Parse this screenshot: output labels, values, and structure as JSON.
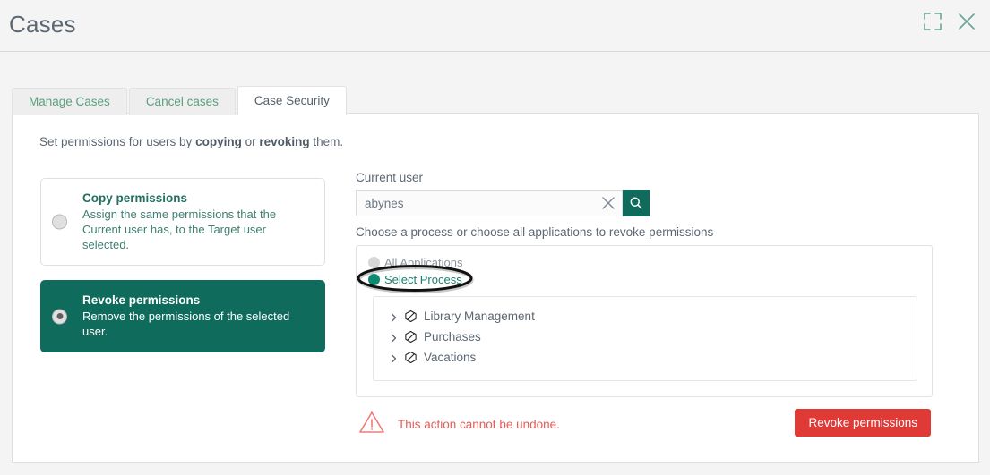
{
  "header": {
    "title": "Cases",
    "expand_icon": "expand-icon",
    "close_icon": "close-icon"
  },
  "tabs": [
    {
      "label": "Manage Cases",
      "active": false
    },
    {
      "label": "Cancel cases",
      "active": false
    },
    {
      "label": "Case Security",
      "active": true
    }
  ],
  "main": {
    "intro_prefix": "Set permissions for users by ",
    "intro_bold1": "copying",
    "intro_mid": " or ",
    "intro_bold2": "revoking",
    "intro_suffix": " them."
  },
  "options": [
    {
      "title": "Copy permissions",
      "description": "Assign the same permissions that the Current user has, to the Target user selected.",
      "selected": false
    },
    {
      "title": "Revoke permissions",
      "description": "Remove the permissions of the selected user.",
      "selected": true
    }
  ],
  "search": {
    "label": "Current user",
    "value": "abynes",
    "placeholder": "",
    "clear_icon": "close-icon",
    "search_icon": "search-icon"
  },
  "process": {
    "help_text": "Choose a process or choose all applications to revoke permissions",
    "radios": [
      {
        "label": "All Applications",
        "selected": false
      },
      {
        "label": "Select Process",
        "selected": true
      }
    ],
    "tree": [
      {
        "label": "Library Management",
        "icon": "package-icon",
        "expanded": false
      },
      {
        "label": "Purchases",
        "icon": "package-icon",
        "expanded": false
      },
      {
        "label": "Vacations",
        "icon": "package-icon",
        "expanded": false
      }
    ]
  },
  "footer": {
    "warning_icon": "warning-triangle-icon",
    "warning_text": "This action cannot be undone.",
    "revoke_button": "Revoke permissions"
  },
  "colors": {
    "brand_teal": "#0f6b5c",
    "danger_red": "#e03a36",
    "warning_red": "#e25c58",
    "tab_green": "#5aa07f",
    "text_gray": "#5c6773"
  }
}
